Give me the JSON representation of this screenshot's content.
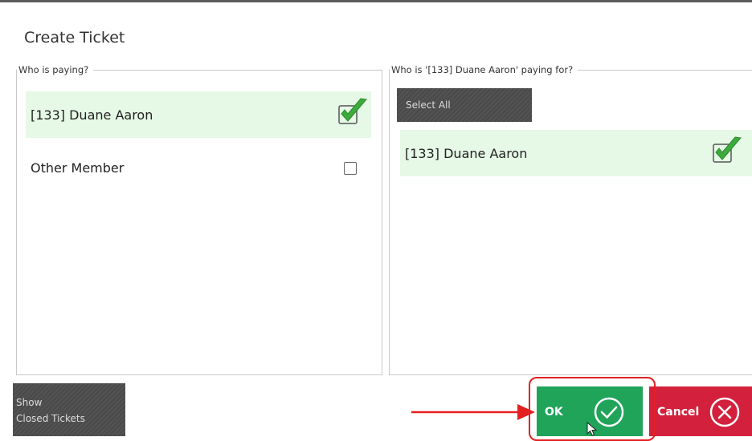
{
  "dialog": {
    "title": "Create Ticket"
  },
  "payer_group": {
    "legend": "Who is paying?",
    "items": [
      {
        "label": "[133] Duane Aaron",
        "checked": true
      },
      {
        "label": "Other Member",
        "checked": false
      }
    ]
  },
  "payee_group": {
    "legend": "Who is '[133] Duane Aaron' paying for?",
    "select_all_label": "Select All",
    "items": [
      {
        "label": "[133] Duane Aaron",
        "checked": true
      }
    ]
  },
  "footer": {
    "show_closed_line1": "Show",
    "show_closed_line2": "Closed Tickets",
    "ok_label": "OK",
    "cancel_label": "Cancel"
  },
  "colors": {
    "selected_row": "#e6f8e6",
    "check_green": "#3daa3d",
    "ok_green": "#1fa45a",
    "cancel_red": "#d3203c",
    "annotation_red": "#e32020",
    "dark_button": "#4a4a4a"
  },
  "icons": [
    "check-mark-icon",
    "checkbox-icon",
    "check-circle-icon",
    "close-circle-icon",
    "arrow-right-icon",
    "mouse-cursor-icon"
  ]
}
